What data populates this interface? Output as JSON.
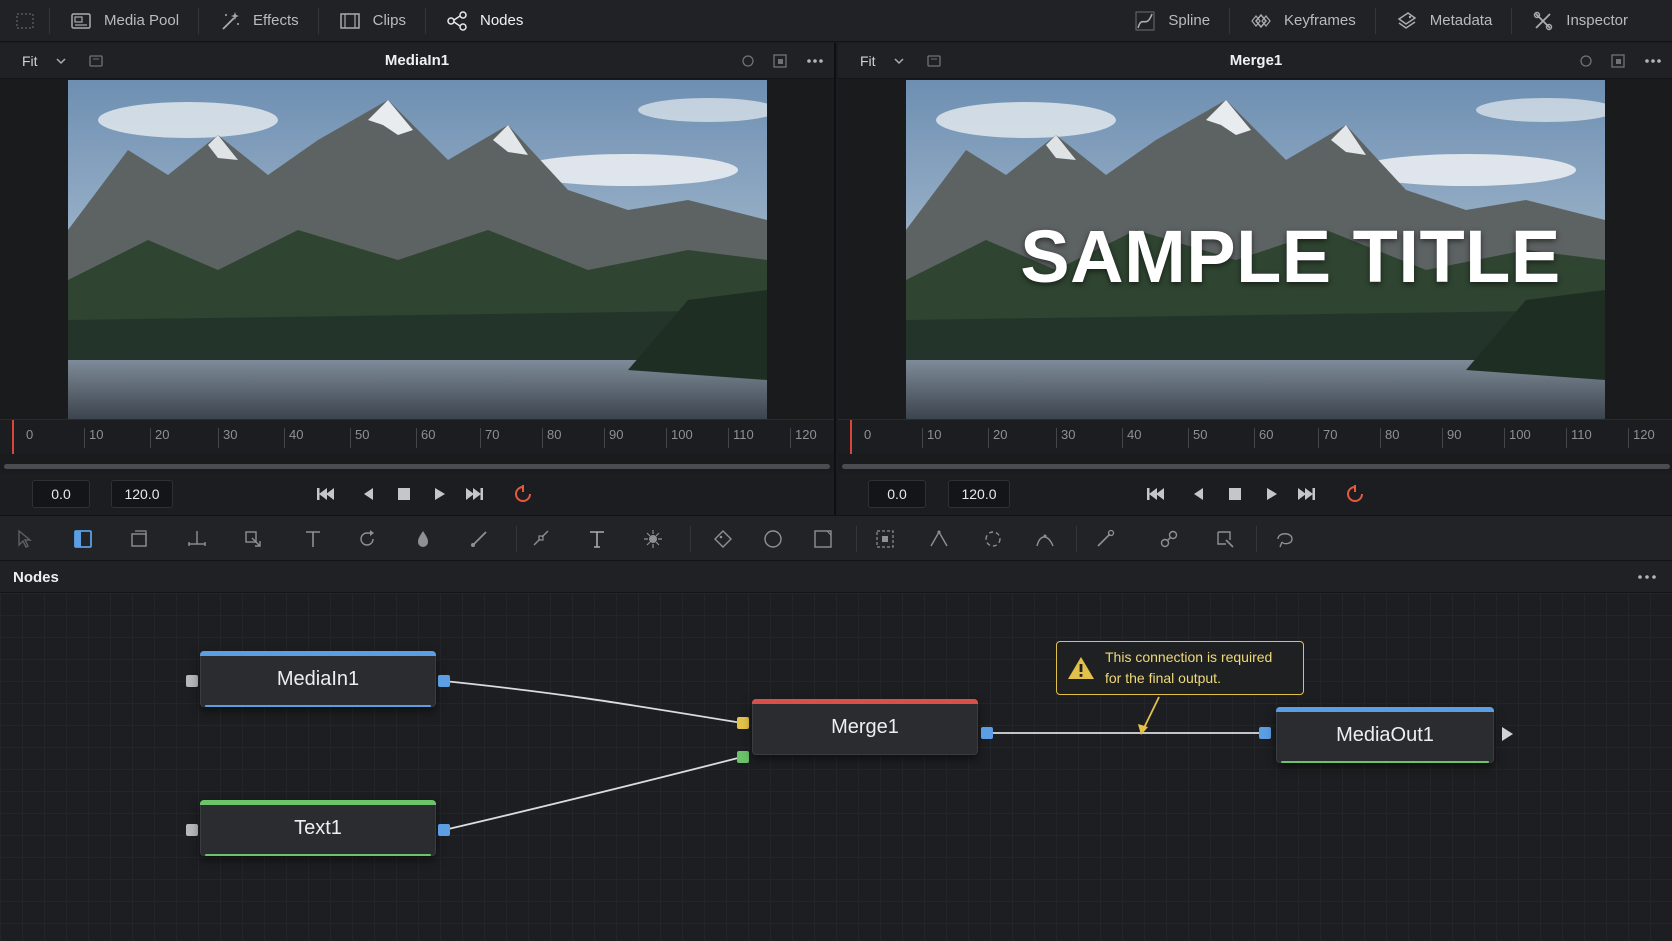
{
  "topbar": {
    "items": [
      {
        "label": "Media Pool",
        "icon": "media-pool-icon"
      },
      {
        "label": "Effects",
        "icon": "effects-wand-icon"
      },
      {
        "label": "Clips",
        "icon": "clips-filmstrip-icon"
      },
      {
        "label": "Nodes",
        "icon": "nodes-graph-icon",
        "active": true
      }
    ],
    "right_items": [
      {
        "label": "Spline",
        "icon": "spline-icon"
      },
      {
        "label": "Keyframes",
        "icon": "keyframes-icon"
      },
      {
        "label": "Metadata",
        "icon": "metadata-icon"
      },
      {
        "label": "Inspector",
        "icon": "inspector-icon"
      }
    ]
  },
  "viewers": [
    {
      "fit_label": "Fit",
      "title": "MediaIn1",
      "overlay_title": "",
      "start_tc": "0.0",
      "end_tc": "120.0"
    },
    {
      "fit_label": "Fit",
      "title": "Merge1",
      "overlay_title": "SAMPLE TITLE",
      "start_tc": "0.0",
      "end_tc": "120.0"
    }
  ],
  "ruler_ticks": [
    "0",
    "10",
    "20",
    "30",
    "40",
    "50",
    "60",
    "70",
    "80",
    "90",
    "100",
    "110",
    "120"
  ],
  "colors": {
    "playhead": "#d9453a",
    "mediain_bar": "#5b9ee3",
    "merge_bar": "#d9504a",
    "text_bar": "#6cc36a",
    "mediaout_bar": "#5b9ee3",
    "warning": "#e2c14a",
    "loop_icon": "#e65a3c"
  },
  "nodes_panel": {
    "title": "Nodes",
    "nodes": [
      {
        "id": "mediain1",
        "label": "MediaIn1"
      },
      {
        "id": "text1",
        "label": "Text1"
      },
      {
        "id": "merge1",
        "label": "Merge1"
      },
      {
        "id": "mediaout1",
        "label": "MediaOut1"
      }
    ],
    "warning_line1": "This connection is required",
    "warning_line2": "for the final output."
  }
}
